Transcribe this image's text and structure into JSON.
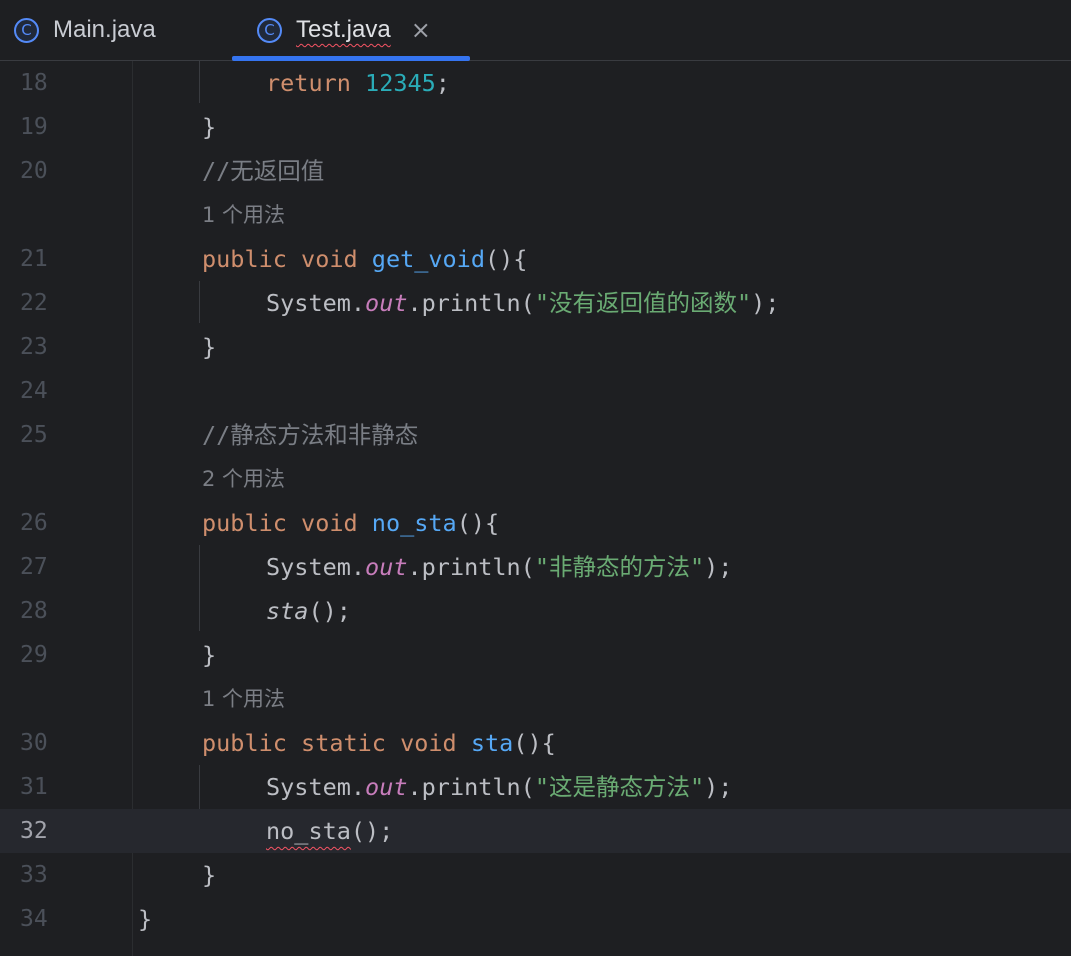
{
  "tabs": [
    {
      "label": "Main.java",
      "icon": "class-icon",
      "active": false
    },
    {
      "label": "Test.java",
      "icon": "class-icon",
      "active": true,
      "has_error": true
    }
  ],
  "tab_close_glyph": "×",
  "class_icon_glyph": "C",
  "colors": {
    "background": "#1e1f22",
    "keyword": "#cf8e6d",
    "number": "#2aacb8",
    "method": "#56a8f5",
    "string": "#6aab73",
    "static_field": "#c77dbb",
    "comment": "#7a7e85",
    "active_tab_indicator": "#3574f0",
    "error_underline": "#f75464"
  },
  "editor": {
    "current_line": "32",
    "line_numbers": [
      "18",
      "19",
      "20",
      "21",
      "22",
      "23",
      "24",
      "25",
      "26",
      "27",
      "28",
      "29",
      "30",
      "31",
      "32",
      "33",
      "34"
    ],
    "comments": {
      "c20": "//无返回值",
      "c25": "//静态方法和非静态"
    },
    "usage_hints": {
      "h21": "1 个用法",
      "h26": "2 个用法",
      "h30": "1 个用法"
    },
    "tokens": {
      "return": "return",
      "num_12345": "12345",
      "semicolon": ";",
      "close_brace": "}",
      "public": "public",
      "void": "void",
      "static": "static",
      "get_void": "get_void",
      "no_sta": "no_sta",
      "sta": "sta",
      "parens_open_brace": "(){",
      "parens_semicolon": "();",
      "system": "System.",
      "out": "out",
      "println_open": ".println(",
      "println_close": ");",
      "str_22": "\"没有返回值的函数\"",
      "str_27": "\"非静态的方法\"",
      "str_31": "\"这是静态方法\""
    }
  }
}
